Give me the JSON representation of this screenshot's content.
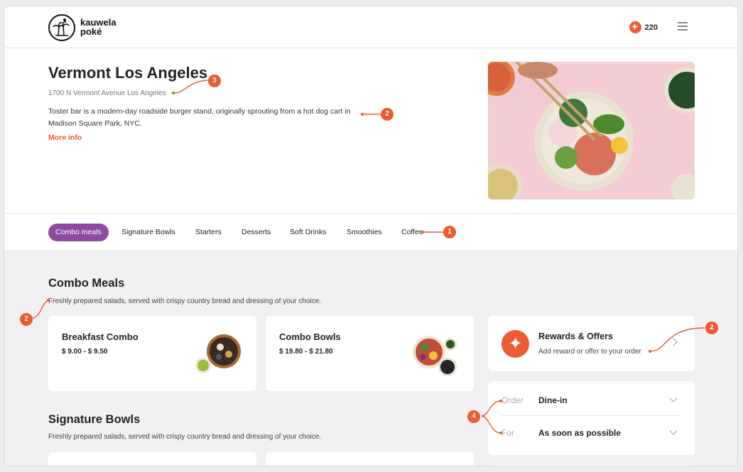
{
  "brand": {
    "line1": "kauwela",
    "line2": "poké"
  },
  "header": {
    "points": "220",
    "points_icon": "star-icon",
    "menu_icon": "hamburger-icon"
  },
  "store": {
    "name": "Vermont Los Angeles",
    "address": "1700 N Vermont Avenue Los Angeles",
    "description": "Toster bar is a modern-day roadside burger stand, originally sprouting from a hot dog cart in Madison Square Park, NYC.",
    "more_info": "More info"
  },
  "tabs": [
    "Combo meals",
    "Signature Bowls",
    "Starters",
    "Desserts",
    "Soft Drinks",
    "Smoothies",
    "Coffee"
  ],
  "sections": [
    {
      "title": "Combo Meals",
      "subtitle": "Freshly prepared salads, served with crispy country bread and dressing of your choice.",
      "items": [
        {
          "name": "Breakfast Combo",
          "price": "$ 9.00 - $ 9.50"
        },
        {
          "name": "Combo Bowls",
          "price": "$ 19.80 - $ 21.80"
        }
      ]
    },
    {
      "title": "Signature Bowls",
      "subtitle": "Freshly prepared salads, served with crispy country bread and dressing of your choice."
    }
  ],
  "rewards": {
    "title": "Rewards & Offers",
    "subtitle": "Add reward or offer to your order"
  },
  "order": {
    "type_label": "Order",
    "type_value": "Dine-in",
    "time_label": "For",
    "time_value": "As soon as possible"
  },
  "annotations": [
    "3",
    "2",
    "1",
    "2",
    "2",
    "4"
  ],
  "colors": {
    "accent": "#ec5a30",
    "tab_active": "#8e4aa3"
  }
}
